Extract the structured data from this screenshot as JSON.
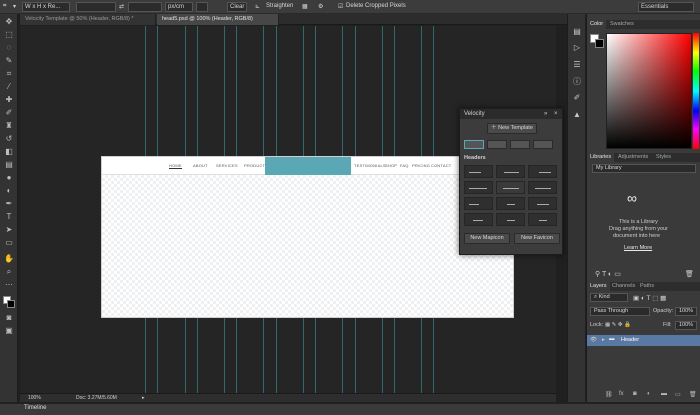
{
  "options_bar": {
    "ratio_value": "W x H x Re...",
    "unit_value": "px/cm",
    "clear_label": "Clear",
    "straighten_label": "Straighten",
    "delete_cropped_label": "Delete Cropped Pixels",
    "workspace": "Essentials"
  },
  "tabs": [
    {
      "label": "Velocity Template @ 50% (Header, RGB/8) *"
    },
    {
      "label": "head5.psd @ 100% (Header, RGB/8)"
    }
  ],
  "document": {
    "nav_links": [
      "HOME",
      "ABOUT",
      "SERVICES",
      "PRODUCTS",
      "TESTIMONIALS",
      "SHOP",
      "FAQ",
      "PRICING",
      "CONTACT"
    ]
  },
  "status": {
    "zoom": "100%",
    "doc_size": "Doc: 3.27M/5.60M"
  },
  "timeline_label": "Timeline",
  "velocity": {
    "title": "Velocity",
    "new_template": "New Template",
    "headers_label": "Headers",
    "new_mapicon": "New Mapicon",
    "new_favicon": "New Favicon"
  },
  "panels": {
    "color_tabs": [
      "Color",
      "Swatches"
    ],
    "library_tabs": [
      "Libraries",
      "Adjustments",
      "Styles"
    ],
    "library_select": "My Library",
    "library_msg1": "This is a Library",
    "library_msg2": "Drag anything from your",
    "library_msg3": "document into here",
    "learn_more": "Learn More",
    "layers_tabs": [
      "Layers",
      "Channels",
      "Paths"
    ],
    "kind": "Kind",
    "blend_mode": "Pass Through",
    "opacity_label": "Opacity:",
    "opacity_value": "100%",
    "lock_label": "Lock:",
    "fill_label": "Fill:",
    "fill_value": "100%",
    "layer_name": "Header"
  },
  "colors": {
    "accent": "#5aa8b6",
    "guide": "#3b8a97",
    "layer_selected": "#5979a3"
  }
}
